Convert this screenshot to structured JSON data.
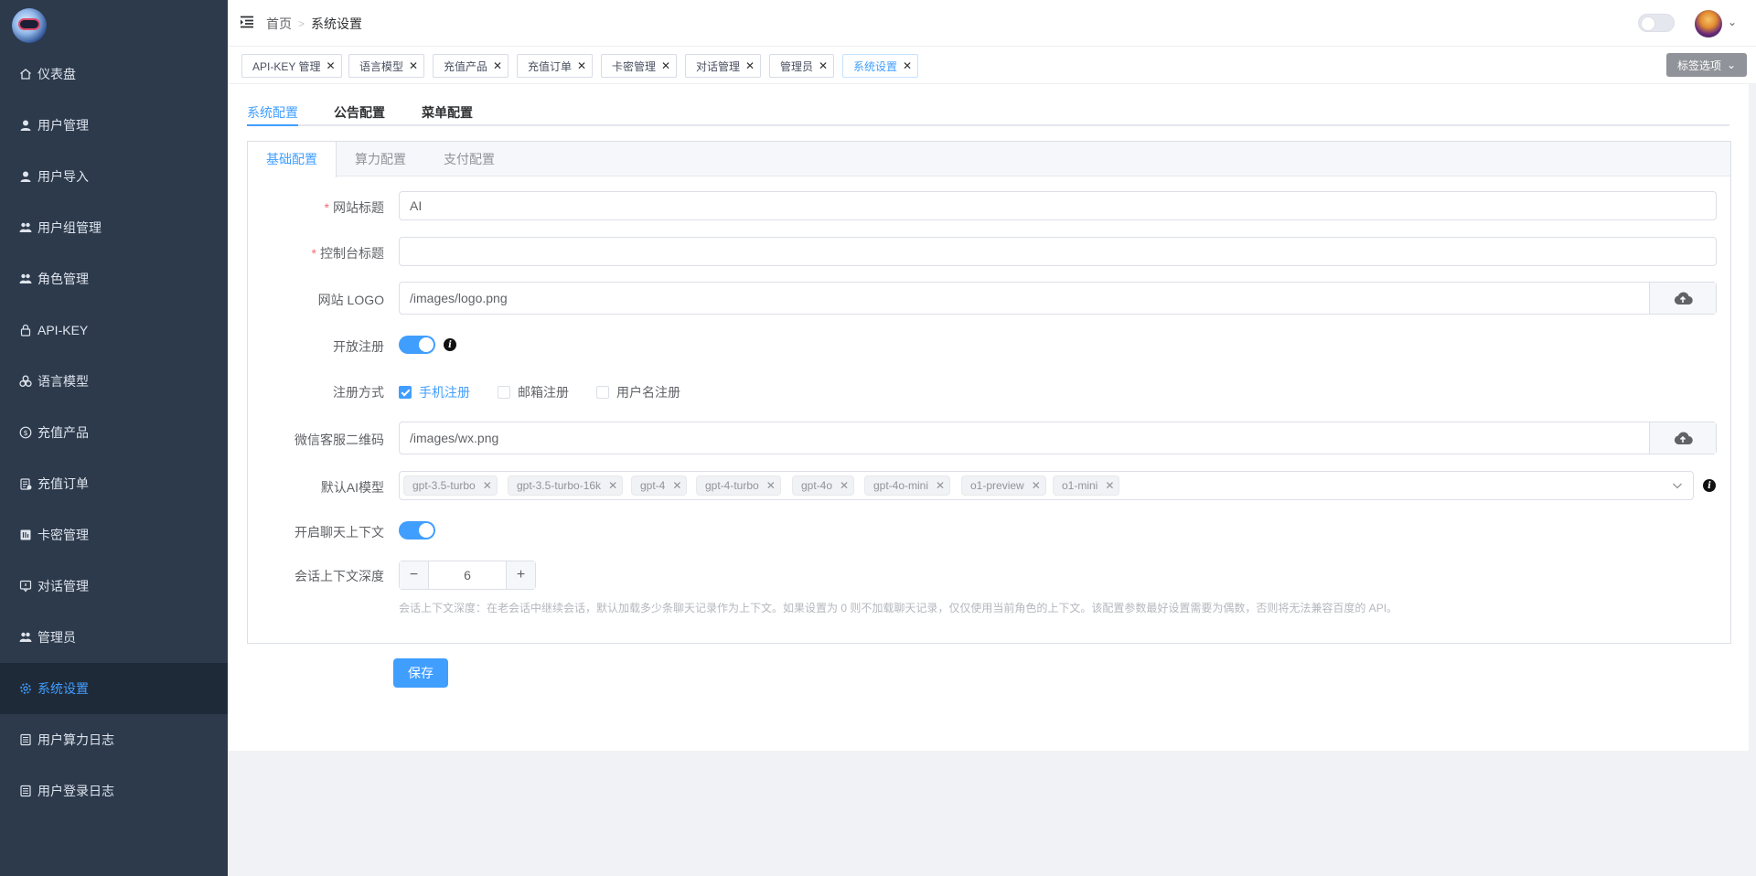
{
  "sidebar": {
    "items": [
      {
        "label": "仪表盘",
        "icon": "home-icon"
      },
      {
        "label": "用户管理",
        "icon": "user-icon"
      },
      {
        "label": "用户导入",
        "icon": "user-icon"
      },
      {
        "label": "用户组管理",
        "icon": "group-icon"
      },
      {
        "label": "角色管理",
        "icon": "group-icon"
      },
      {
        "label": "API-KEY",
        "icon": "lock-icon"
      },
      {
        "label": "语言模型",
        "icon": "model-icon"
      },
      {
        "label": "充值产品",
        "icon": "coin-icon"
      },
      {
        "label": "充值订单",
        "icon": "order-icon"
      },
      {
        "label": "卡密管理",
        "icon": "card-icon"
      },
      {
        "label": "对话管理",
        "icon": "chat-icon"
      },
      {
        "label": "管理员",
        "icon": "admin-icon"
      },
      {
        "label": "系统设置",
        "icon": "gear-icon"
      },
      {
        "label": "用户算力日志",
        "icon": "log-icon"
      },
      {
        "label": "用户登录日志",
        "icon": "log-icon"
      }
    ],
    "active_index": 12,
    "active_color": "#409eff"
  },
  "header": {
    "breadcrumb": [
      "首页",
      "系统设置"
    ]
  },
  "tags": {
    "items": [
      "API-KEY 管理",
      "语言模型",
      "充值产品",
      "充值订单",
      "卡密管理",
      "对话管理",
      "管理员",
      "系统设置"
    ],
    "active_index": 7,
    "options_label": "标签选项"
  },
  "tabs": {
    "items": [
      "系统配置",
      "公告配置",
      "菜单配置"
    ],
    "active_index": 0
  },
  "inner_tabs": {
    "items": [
      "基础配置",
      "算力配置",
      "支付配置"
    ],
    "active_index": 0
  },
  "form": {
    "site_title": {
      "label": "网站标题",
      "value": "AI",
      "required": true
    },
    "console_title": {
      "label": "控制台标题",
      "value": "",
      "required": true
    },
    "site_logo": {
      "label": "网站 LOGO",
      "value": "/images/logo.png"
    },
    "open_register": {
      "label": "开放注册",
      "on": true
    },
    "register_methods": {
      "label": "注册方式",
      "options": [
        {
          "label": "手机注册",
          "checked": true
        },
        {
          "label": "邮箱注册",
          "checked": false
        },
        {
          "label": "用户名注册",
          "checked": false
        }
      ]
    },
    "wechat_qr": {
      "label": "微信客服二维码",
      "value": "/images/wx.png"
    },
    "default_models": {
      "label": "默认AI模型",
      "values": [
        "gpt-3.5-turbo",
        "gpt-3.5-turbo-16k",
        "gpt-4",
        "gpt-4-turbo",
        "gpt-4o",
        "gpt-4o-mini",
        "o1-preview",
        "o1-mini"
      ]
    },
    "chat_context": {
      "label": "开启聊天上下文",
      "on": true
    },
    "context_depth": {
      "label": "会话上下文深度",
      "value": "6",
      "hint": "会话上下文深度：在老会话中继续会话，默认加载多少条聊天记录作为上下文。如果设置为 0 则不加载聊天记录，仅仅使用当前角色的上下文。该配置参数最好设置需要为偶数，否则将无法兼容百度的 API。"
    },
    "save_label": "保存"
  }
}
